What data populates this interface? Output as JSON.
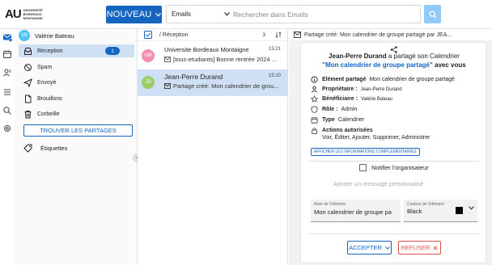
{
  "colors": {
    "accent": "#1565c0",
    "selected": "#cfe0f4",
    "danger": "#d9534f",
    "avatar_vb": "#4fc3f7",
    "avatar_um": "#f48fb1",
    "avatar_jd": "#9ccc65"
  },
  "header": {
    "logo_mark": "AU",
    "logo_text": [
      "UNIVERSITÉ",
      "BORDEAUX",
      "MONTAIGNE"
    ],
    "new_button": "NOUVEAU",
    "search_scope": "Emails",
    "search_placeholder": "Rechercher dans Emails",
    "search_icon": "search-icon"
  },
  "rail": {
    "icons": [
      "mail-icon",
      "calendar-icon",
      "contacts-icon",
      "tasks-icon",
      "search-icon",
      "settings-icon"
    ]
  },
  "sidebar": {
    "user": {
      "initials": "VB",
      "name": "Valérie Bateau"
    },
    "folders": [
      {
        "label": "Réception",
        "icon": "inbox-icon",
        "count": "1",
        "active": true
      },
      {
        "label": "Spam",
        "icon": "spam-icon"
      },
      {
        "label": "Envoyé",
        "icon": "send-icon"
      },
      {
        "label": "Brouillons",
        "icon": "draft-icon"
      },
      {
        "label": "Corbeille",
        "icon": "trash-icon"
      }
    ],
    "find_shares": "TROUVER LES PARTAGES",
    "labels": "Étiquettes",
    "collapse": "‹"
  },
  "list": {
    "folder": "/ Réception",
    "count": "3",
    "sort_icon": "sort-icon",
    "messages": [
      {
        "initials": "UM",
        "from": "Universite Bordeaux Montaigne",
        "time": "15:21",
        "subject": "[tous-etudiants] Bonne rentrée 2024 ..."
      },
      {
        "initials": "JD",
        "from": "Jean-Perre Durand",
        "time": "15:10",
        "subject": "Partage créé: Mon calendrier de grou..."
      }
    ]
  },
  "reader": {
    "title": "Partage créé: Mon calendrier de groupe partagé par JEA...",
    "headline_user": "Jean-Perre Durand",
    "headline_mid": "a partagé son Calendrier",
    "headline_cal": "\"Mon calendrier de groupe partagé\"",
    "headline_end": "avec vous",
    "rows": {
      "element_label": "Elément partagé",
      "element_value": "Mon calendrier de groupe partagé",
      "owner_label": "Propriétaire :",
      "owner_value": "Jean-Perre Durand",
      "beneficiary_label": "Bénéficiaire :",
      "beneficiary_value": "Valérie Bateau",
      "role_label": "Rôle :",
      "role_value": "Admin",
      "type_label": "Type",
      "type_value": "Calendrier",
      "actions_label": "Actions autorisées",
      "actions_value": "Voir, Éditer, Ajouter, Supprimer, Administrer"
    },
    "more_info": "AFFICHER LES INFORMATIONS COMPLEMENTAIRES",
    "notify": "Notifier l'organisateur",
    "message_placeholder": "Ajouter un message personnalisé",
    "name_field_label": "Nom de l'élément",
    "name_field_value": "Mon calendrier de groupe pa",
    "color_field_label": "Couleur de l'élément",
    "color_field_value": "Black",
    "accept": "ACCEPTER",
    "refuse": "REFUSER"
  }
}
